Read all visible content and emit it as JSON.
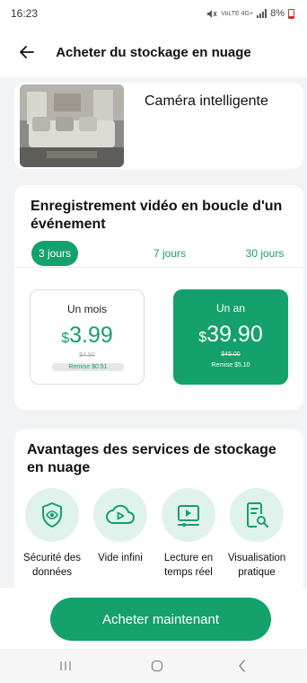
{
  "status_bar": {
    "time": "16:23",
    "network": "VoLTE 4G+",
    "battery": "8%"
  },
  "header": {
    "title": "Acheter du stockage en nuage"
  },
  "device": {
    "name": "Caméra intelligente"
  },
  "plan": {
    "title": "Enregistrement vidéo en boucle d'un événement",
    "tabs": [
      {
        "label": "3 jours",
        "active": true
      },
      {
        "label": "7 jours",
        "active": false
      },
      {
        "label": "30 jours",
        "active": false
      }
    ],
    "options": [
      {
        "period": "Un mois",
        "currency": "$",
        "price": "3.99",
        "old_price": "$4.50",
        "discount": "Remise $0.51",
        "selected": false
      },
      {
        "period": "Un an",
        "currency": "$",
        "price": "39.90",
        "old_price": "$45.00",
        "discount": "Remise $5.10",
        "selected": true
      }
    ]
  },
  "benefits": {
    "title": "Avantages des services de stockage en nuage",
    "items": [
      {
        "label": "Sécurité des données",
        "icon": "shield-eye-icon"
      },
      {
        "label": "Vide infini",
        "icon": "cloud-play-icon"
      },
      {
        "label": "Lecture en temps réel",
        "icon": "video-play-icon"
      },
      {
        "label": "Visualisation pratique",
        "icon": "document-search-icon"
      }
    ]
  },
  "buy_button": {
    "label": "Acheter maintenant"
  },
  "colors": {
    "accent": "#14a16b",
    "accent_light": "#dff2ec",
    "background": "#f2f3f5"
  }
}
